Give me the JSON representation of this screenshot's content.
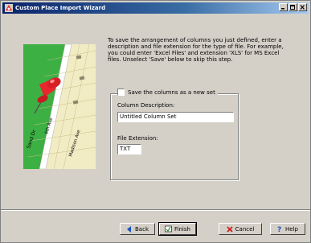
{
  "window": {
    "title": "Custom Place Import Wizard"
  },
  "instructions": "To save the arrangement of columns you just defined, enter a description and file extension for the type of file. For example, you could enter 'Excel Files' and extension 'XLS' for MS Excel files. Unselect 'Save' below to skip this step.",
  "save_checkbox": {
    "label": "Save the columns as a new set",
    "checked": false
  },
  "column_description": {
    "label": "Column Description:",
    "value": "Untitled Column Set"
  },
  "file_extension": {
    "label": "File Extension:",
    "value": "TXT"
  },
  "map": {
    "streets": [
      "Sand Dr",
      "6th Ave",
      "Madison Ave"
    ]
  },
  "buttons": {
    "back": "Back",
    "finish": "Finish",
    "cancel": "Cancel",
    "help": "Help"
  },
  "colors": {
    "title_bar": "#0a246a",
    "park": "#3cb043",
    "pushpin": "#e8262d"
  }
}
